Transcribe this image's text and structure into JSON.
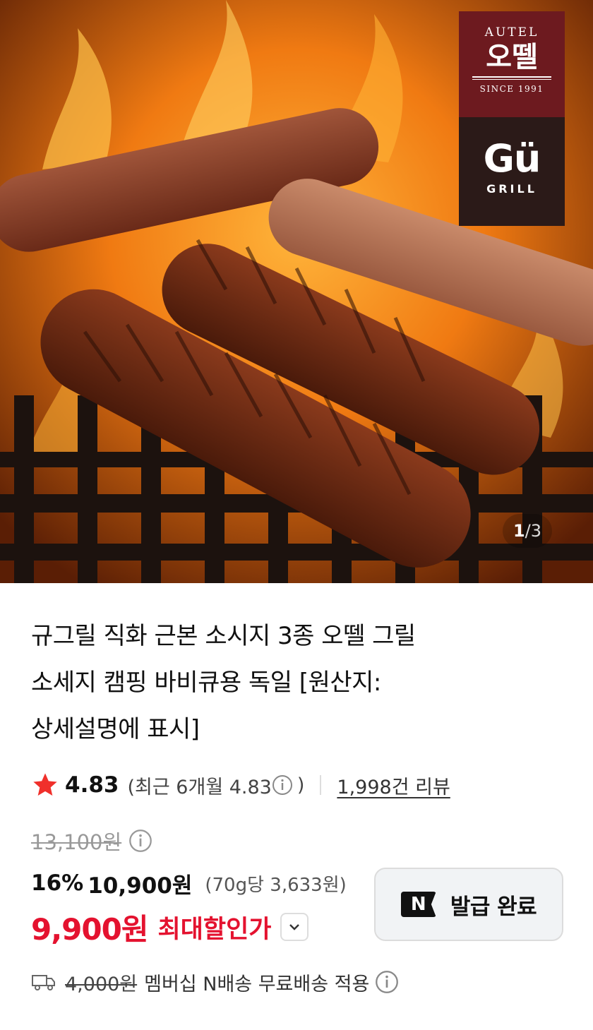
{
  "gallery": {
    "brand_en": "AUTEL",
    "brand_ko": "오뗄",
    "brand_since": "SINCE 1991",
    "sub_brand": "Gü",
    "sub_brand_tag": "GRILL",
    "page_current": "1",
    "page_separator": "/",
    "page_total": "3"
  },
  "product": {
    "title_lines": [
      "규그릴 직화 근본 소시지 3종 오뗄 그릴",
      "소세지 캠핑 바비큐용 독일 [원산지:",
      "상세설명에 표시]"
    ]
  },
  "rating": {
    "score": "4.83",
    "recent_prefix": "(최근 6개월 4.83",
    "recent_suffix": ")",
    "review_count": "1,998건 리뷰"
  },
  "price": {
    "original": "13,100원",
    "discount_rate": "16%",
    "discounted": "10,900원",
    "unit_price": "(70g당 3,633원)",
    "final": "9,900원",
    "final_label": "최대할인가"
  },
  "coupon": {
    "logo_text": "N",
    "label": "발급 완료"
  },
  "shipping": {
    "original_fee": "4,000원",
    "text": "멤버십 N배송 무료배송 적용"
  },
  "colors": {
    "accent_red": "#e4122f",
    "brand_maroon": "#6d1a1f",
    "star": "#f0302b"
  },
  "icons": [
    "star-icon",
    "info-icon",
    "chevron-down-icon",
    "truck-icon",
    "n-logo-icon"
  ]
}
